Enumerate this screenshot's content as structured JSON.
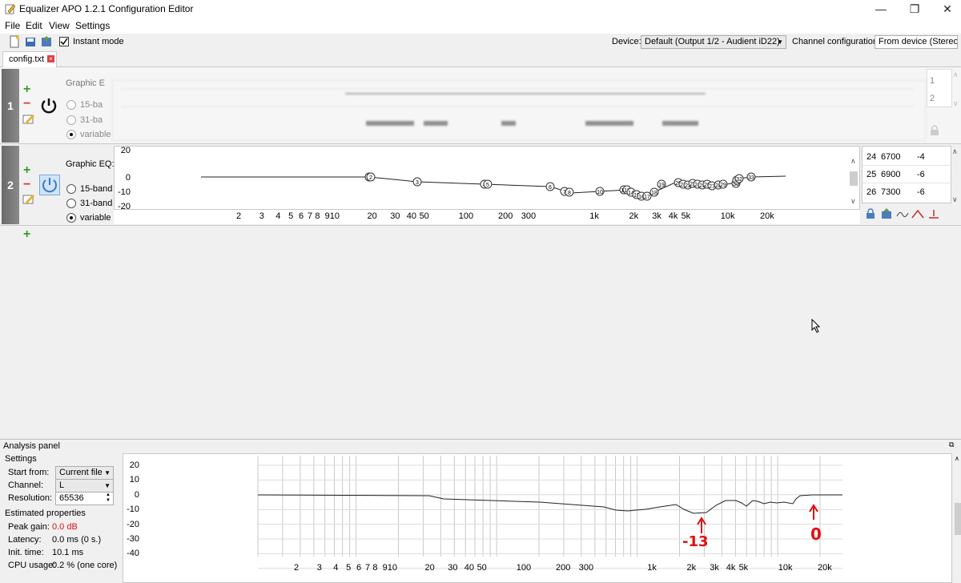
{
  "window": {
    "title": "Equalizer APO 1.2.1 Configuration Editor"
  },
  "menu": {
    "file": "File",
    "edit": "Edit",
    "view": "View",
    "settings": "Settings"
  },
  "toolbar": {
    "instant_mode_label": "Instant mode",
    "instant_mode_checked": true,
    "device_label": "Device:",
    "device_value": "Default (Output 1/2 - Audient iD22)",
    "channel_config_label": "Channel configuration:",
    "channel_config_value": "From device (Stereo)"
  },
  "tab": {
    "label": "config.txt"
  },
  "filter1": {
    "number": "1",
    "title": "Graphic E",
    "opt_15": "15-ba",
    "opt_31": "31-ba",
    "opt_var": "variable",
    "table_rows": [
      "1",
      "2"
    ]
  },
  "filter2": {
    "number": "2",
    "title": "Graphic EQ:",
    "opt_15": "15-band",
    "opt_31": "31-band",
    "opt_var": "variable",
    "selected": "variable",
    "y_ticks": [
      "20",
      "0",
      "-10",
      "-20"
    ],
    "x_ticks": [
      "2",
      "3",
      "4",
      "5",
      "6",
      "7",
      "8",
      "910",
      "20",
      "30",
      "40",
      "50",
      "100",
      "200",
      "300",
      "1k",
      "2k",
      "3k",
      "4k",
      "5k",
      "10k",
      "20k"
    ],
    "table": [
      {
        "num": "24",
        "freq": "6700",
        "gain": "-4"
      },
      {
        "num": "25",
        "freq": "6900",
        "gain": "-6"
      },
      {
        "num": "26",
        "freq": "7300",
        "gain": "-6"
      }
    ],
    "point_labels": [
      "1",
      "2",
      "3",
      "4",
      "5",
      "6",
      "7",
      "8",
      "10",
      "12",
      "13",
      "14",
      "15",
      "16",
      "17",
      "18",
      "19",
      "20",
      "21",
      "22",
      "23",
      "24",
      "25",
      "26",
      "27",
      "28",
      "29",
      "30",
      "31",
      "32",
      "33"
    ]
  },
  "analysis": {
    "panel_title": "Analysis panel",
    "settings_title": "Settings",
    "start_from_label": "Start from:",
    "start_from_value": "Current file",
    "channel_label": "Channel:",
    "channel_value": "L",
    "resolution_label": "Resolution:",
    "resolution_value": "65536",
    "estimated_title": "Estimated properties",
    "peak_gain_label": "Peak gain:",
    "peak_gain_value": "0.0 dB",
    "latency_label": "Latency:",
    "latency_value": "0.0 ms (0 s.)",
    "init_time_label": "Init. time:",
    "init_time_value": "10.1 ms",
    "cpu_label": "CPU usage:",
    "cpu_value": "0.2 % (one core)",
    "y_ticks": [
      "20",
      "10",
      "0",
      "-10",
      "-20",
      "-30",
      "-40"
    ],
    "x_ticks": [
      "2",
      "3",
      "4",
      "5",
      "6",
      "7",
      "8",
      "910",
      "20",
      "30",
      "40",
      "50",
      "100",
      "200",
      "300",
      "1k",
      "2k",
      "3k",
      "4k",
      "5k",
      "10k",
      "20k"
    ],
    "annotation_a": "-13",
    "annotation_b": "0"
  },
  "colors": {
    "peak_gain": "#e01010",
    "annotation": "#e01010",
    "add": "#3a9a2a",
    "remove": "#d23a3a"
  }
}
